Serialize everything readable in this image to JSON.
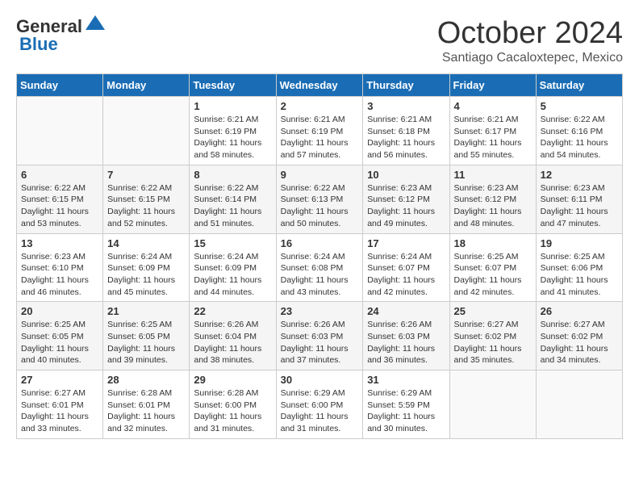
{
  "header": {
    "logo_general": "General",
    "logo_blue": "Blue",
    "month": "October 2024",
    "location": "Santiago Cacaloxtepec, Mexico"
  },
  "days_of_week": [
    "Sunday",
    "Monday",
    "Tuesday",
    "Wednesday",
    "Thursday",
    "Friday",
    "Saturday"
  ],
  "weeks": [
    [
      {
        "day": "",
        "info": ""
      },
      {
        "day": "",
        "info": ""
      },
      {
        "day": "1",
        "info": "Sunrise: 6:21 AM\nSunset: 6:19 PM\nDaylight: 11 hours and 58 minutes."
      },
      {
        "day": "2",
        "info": "Sunrise: 6:21 AM\nSunset: 6:19 PM\nDaylight: 11 hours and 57 minutes."
      },
      {
        "day": "3",
        "info": "Sunrise: 6:21 AM\nSunset: 6:18 PM\nDaylight: 11 hours and 56 minutes."
      },
      {
        "day": "4",
        "info": "Sunrise: 6:21 AM\nSunset: 6:17 PM\nDaylight: 11 hours and 55 minutes."
      },
      {
        "day": "5",
        "info": "Sunrise: 6:22 AM\nSunset: 6:16 PM\nDaylight: 11 hours and 54 minutes."
      }
    ],
    [
      {
        "day": "6",
        "info": "Sunrise: 6:22 AM\nSunset: 6:15 PM\nDaylight: 11 hours and 53 minutes."
      },
      {
        "day": "7",
        "info": "Sunrise: 6:22 AM\nSunset: 6:15 PM\nDaylight: 11 hours and 52 minutes."
      },
      {
        "day": "8",
        "info": "Sunrise: 6:22 AM\nSunset: 6:14 PM\nDaylight: 11 hours and 51 minutes."
      },
      {
        "day": "9",
        "info": "Sunrise: 6:22 AM\nSunset: 6:13 PM\nDaylight: 11 hours and 50 minutes."
      },
      {
        "day": "10",
        "info": "Sunrise: 6:23 AM\nSunset: 6:12 PM\nDaylight: 11 hours and 49 minutes."
      },
      {
        "day": "11",
        "info": "Sunrise: 6:23 AM\nSunset: 6:12 PM\nDaylight: 11 hours and 48 minutes."
      },
      {
        "day": "12",
        "info": "Sunrise: 6:23 AM\nSunset: 6:11 PM\nDaylight: 11 hours and 47 minutes."
      }
    ],
    [
      {
        "day": "13",
        "info": "Sunrise: 6:23 AM\nSunset: 6:10 PM\nDaylight: 11 hours and 46 minutes."
      },
      {
        "day": "14",
        "info": "Sunrise: 6:24 AM\nSunset: 6:09 PM\nDaylight: 11 hours and 45 minutes."
      },
      {
        "day": "15",
        "info": "Sunrise: 6:24 AM\nSunset: 6:09 PM\nDaylight: 11 hours and 44 minutes."
      },
      {
        "day": "16",
        "info": "Sunrise: 6:24 AM\nSunset: 6:08 PM\nDaylight: 11 hours and 43 minutes."
      },
      {
        "day": "17",
        "info": "Sunrise: 6:24 AM\nSunset: 6:07 PM\nDaylight: 11 hours and 42 minutes."
      },
      {
        "day": "18",
        "info": "Sunrise: 6:25 AM\nSunset: 6:07 PM\nDaylight: 11 hours and 42 minutes."
      },
      {
        "day": "19",
        "info": "Sunrise: 6:25 AM\nSunset: 6:06 PM\nDaylight: 11 hours and 41 minutes."
      }
    ],
    [
      {
        "day": "20",
        "info": "Sunrise: 6:25 AM\nSunset: 6:05 PM\nDaylight: 11 hours and 40 minutes."
      },
      {
        "day": "21",
        "info": "Sunrise: 6:25 AM\nSunset: 6:05 PM\nDaylight: 11 hours and 39 minutes."
      },
      {
        "day": "22",
        "info": "Sunrise: 6:26 AM\nSunset: 6:04 PM\nDaylight: 11 hours and 38 minutes."
      },
      {
        "day": "23",
        "info": "Sunrise: 6:26 AM\nSunset: 6:03 PM\nDaylight: 11 hours and 37 minutes."
      },
      {
        "day": "24",
        "info": "Sunrise: 6:26 AM\nSunset: 6:03 PM\nDaylight: 11 hours and 36 minutes."
      },
      {
        "day": "25",
        "info": "Sunrise: 6:27 AM\nSunset: 6:02 PM\nDaylight: 11 hours and 35 minutes."
      },
      {
        "day": "26",
        "info": "Sunrise: 6:27 AM\nSunset: 6:02 PM\nDaylight: 11 hours and 34 minutes."
      }
    ],
    [
      {
        "day": "27",
        "info": "Sunrise: 6:27 AM\nSunset: 6:01 PM\nDaylight: 11 hours and 33 minutes."
      },
      {
        "day": "28",
        "info": "Sunrise: 6:28 AM\nSunset: 6:01 PM\nDaylight: 11 hours and 32 minutes."
      },
      {
        "day": "29",
        "info": "Sunrise: 6:28 AM\nSunset: 6:00 PM\nDaylight: 11 hours and 31 minutes."
      },
      {
        "day": "30",
        "info": "Sunrise: 6:29 AM\nSunset: 6:00 PM\nDaylight: 11 hours and 31 minutes."
      },
      {
        "day": "31",
        "info": "Sunrise: 6:29 AM\nSunset: 5:59 PM\nDaylight: 11 hours and 30 minutes."
      },
      {
        "day": "",
        "info": ""
      },
      {
        "day": "",
        "info": ""
      }
    ]
  ]
}
